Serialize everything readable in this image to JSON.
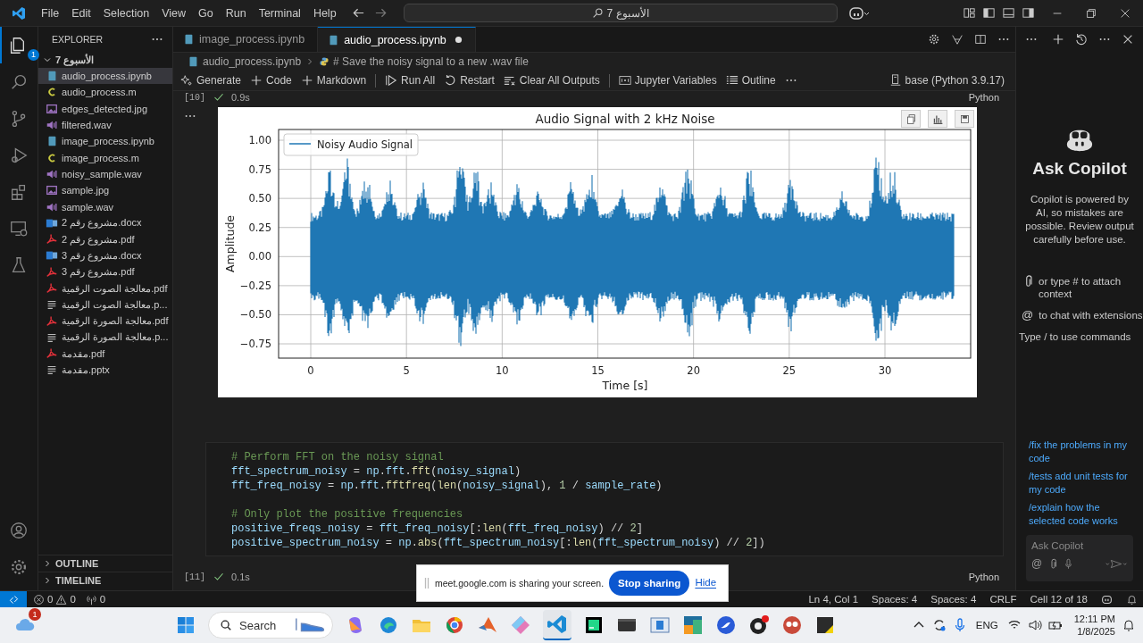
{
  "title_bar": {
    "menu": [
      "File",
      "Edit",
      "Selection",
      "View",
      "Go",
      "Run",
      "Terminal",
      "Help"
    ],
    "search": "الأسبوع 7"
  },
  "activity_bar": {
    "explorer_badge": "1"
  },
  "explorer": {
    "title": "EXPLORER",
    "folder": {
      "name": "الأسبوع 7",
      "expanded": true
    },
    "files": [
      {
        "name": "audio_process.ipynb",
        "kind": "notebook",
        "selected": true
      },
      {
        "name": "audio_process.m",
        "kind": "c",
        "selected": false
      },
      {
        "name": "edges_detected.jpg",
        "kind": "image",
        "selected": false
      },
      {
        "name": "filtered.wav",
        "kind": "audio",
        "selected": false
      },
      {
        "name": "image_process.ipynb",
        "kind": "notebook",
        "selected": false
      },
      {
        "name": "image_process.m",
        "kind": "c",
        "selected": false
      },
      {
        "name": "noisy_sample.wav",
        "kind": "audio",
        "selected": false
      },
      {
        "name": "sample.jpg",
        "kind": "image",
        "selected": false
      },
      {
        "name": "sample.wav",
        "kind": "audio",
        "selected": false
      },
      {
        "name": "مشروع رقم 2.docx",
        "kind": "word",
        "selected": false
      },
      {
        "name": "مشروع رقم 2.pdf",
        "kind": "pdf",
        "selected": false
      },
      {
        "name": "مشروع رقم 3.docx",
        "kind": "word",
        "selected": false
      },
      {
        "name": "مشروع رقم 3.pdf",
        "kind": "pdf",
        "selected": false
      },
      {
        "name": "معالجة الصوت الرقمية.pdf",
        "kind": "pdf",
        "selected": false
      },
      {
        "name": "معالجة الصوت الرقمية.p...",
        "kind": "text",
        "selected": false
      },
      {
        "name": "معالجة الصورة الرقمية.pdf",
        "kind": "pdf",
        "selected": false
      },
      {
        "name": "معالجة الصورة الرقمية.p...",
        "kind": "text",
        "selected": false
      },
      {
        "name": "مقدمة.pdf",
        "kind": "pdf",
        "selected": false
      },
      {
        "name": "مقدمة.pptx",
        "kind": "text",
        "selected": false
      }
    ],
    "sections": [
      {
        "title": "OUTLINE",
        "expanded": false
      },
      {
        "title": "TIMELINE",
        "expanded": false
      }
    ]
  },
  "tabs": [
    {
      "label": "image_process.ipynb",
      "selected": false,
      "modified": false
    },
    {
      "label": "audio_process.ipynb",
      "selected": true,
      "modified": true
    }
  ],
  "breadcrumb": [
    "audio_process.ipynb",
    "# Save the noisy signal to a new .wav file"
  ],
  "toolbar": {
    "actions": [
      {
        "label": "Generate",
        "kind": "sparkle"
      },
      {
        "label": "Code",
        "kind": "plus"
      },
      {
        "label": "Markdown",
        "kind": "plus"
      },
      {
        "label": "Run All",
        "kind": "run"
      },
      {
        "label": "Restart",
        "kind": "restart"
      },
      {
        "label": "Clear All Outputs",
        "kind": "clear"
      },
      {
        "label": "Jupyter Variables",
        "kind": "variables"
      },
      {
        "label": "Outline",
        "kind": "list"
      }
    ],
    "kernel": "base (Python 3.9.17)"
  },
  "output_cell": {
    "exec": "[10]",
    "duration": "0.9s",
    "language": "Python",
    "plot": {
      "title": "Audio Signal with 2 kHz Noise",
      "legend": "Noisy Audio Signal",
      "xlabel": "Time [s]",
      "ylabel": "Amplitude",
      "xticks": [
        "0",
        "5",
        "10",
        "15",
        "20",
        "25",
        "30"
      ],
      "yticks": [
        "1.00",
        "0.75",
        "0.50",
        "0.25",
        "0.00",
        "−0.25",
        "−0.50",
        "−0.75"
      ]
    }
  },
  "code_cell": {
    "exec": "[11]",
    "duration": "0.1s",
    "language": "Python",
    "blocks": [
      [
        [
          {
            "text": "# Perform FFT on the noisy signal",
            "kind": "comment"
          }
        ],
        [
          {
            "text": "fft_spectrum_noisy",
            "kind": "var"
          },
          {
            "text": " = ",
            "kind": "op"
          },
          {
            "text": "np",
            "kind": "var"
          },
          {
            "text": ".",
            "kind": "op"
          },
          {
            "text": "fft",
            "kind": "var"
          },
          {
            "text": ".",
            "kind": "op"
          },
          {
            "text": "fft",
            "kind": "fn"
          },
          {
            "text": "(",
            "kind": "op"
          },
          {
            "text": "noisy_signal",
            "kind": "var"
          },
          {
            "text": ")",
            "kind": "op"
          }
        ],
        [
          {
            "text": "fft_freq_noisy",
            "kind": "var"
          },
          {
            "text": " = ",
            "kind": "op"
          },
          {
            "text": "np",
            "kind": "var"
          },
          {
            "text": ".",
            "kind": "op"
          },
          {
            "text": "fft",
            "kind": "var"
          },
          {
            "text": ".",
            "kind": "op"
          },
          {
            "text": "fftfreq",
            "kind": "fn"
          },
          {
            "text": "(",
            "kind": "op"
          },
          {
            "text": "len",
            "kind": "fn"
          },
          {
            "text": "(",
            "kind": "op"
          },
          {
            "text": "noisy_signal",
            "kind": "var"
          },
          {
            "text": "), ",
            "kind": "op"
          },
          {
            "text": "1",
            "kind": "num"
          },
          {
            "text": " / ",
            "kind": "op"
          },
          {
            "text": "sample_rate",
            "kind": "var"
          },
          {
            "text": ")",
            "kind": "op"
          }
        ]
      ],
      [
        [
          {
            "text": "# Only plot the positive frequencies",
            "kind": "comment"
          }
        ],
        [
          {
            "text": "positive_freqs_noisy",
            "kind": "var"
          },
          {
            "text": " = ",
            "kind": "op"
          },
          {
            "text": "fft_freq_noisy",
            "kind": "var"
          },
          {
            "text": "[:",
            "kind": "op"
          },
          {
            "text": "len",
            "kind": "fn"
          },
          {
            "text": "(",
            "kind": "op"
          },
          {
            "text": "fft_freq_noisy",
            "kind": "var"
          },
          {
            "text": ") // ",
            "kind": "op"
          },
          {
            "text": "2",
            "kind": "num"
          },
          {
            "text": "]",
            "kind": "op"
          }
        ],
        [
          {
            "text": "positive_spectrum_noisy",
            "kind": "var"
          },
          {
            "text": " = ",
            "kind": "op"
          },
          {
            "text": "np",
            "kind": "var"
          },
          {
            "text": ".",
            "kind": "op"
          },
          {
            "text": "abs",
            "kind": "fn"
          },
          {
            "text": "(",
            "kind": "op"
          },
          {
            "text": "fft_spectrum_noisy",
            "kind": "var"
          },
          {
            "text": "[:",
            "kind": "op"
          },
          {
            "text": "len",
            "kind": "fn"
          },
          {
            "text": "(",
            "kind": "op"
          },
          {
            "text": "fft_spectrum_noisy",
            "kind": "var"
          },
          {
            "text": ") // ",
            "kind": "op"
          },
          {
            "text": "2",
            "kind": "num"
          },
          {
            "text": "])",
            "kind": "op"
          }
        ]
      ]
    ]
  },
  "sharing_bar": {
    "message": "meet.google.com is sharing your screen.",
    "stop": "Stop sharing",
    "hide": "Hide"
  },
  "copilot": {
    "title": "Ask Copilot",
    "description": "Copilot is powered by AI, so mistakes are possible. Review output carefully before use.",
    "hints": [
      {
        "kind": "attach",
        "text": "or type # to attach context"
      },
      {
        "kind": "mention",
        "symbol": "@",
        "text": "to chat with extensions"
      },
      {
        "kind": "plain",
        "text": "Type / to use commands"
      }
    ],
    "suggestions": [
      "/fix the problems in my code",
      "/tests add unit tests for my code",
      "/explain how the selected code works"
    ],
    "input": {
      "placeholder": "Ask Copilot",
      "symbol": "@"
    }
  },
  "status_bar": {
    "errors": "0",
    "warnings": "0",
    "ports": "0",
    "items": [
      "Ln 4, Col 1",
      "Spaces: 4",
      "Spaces: 4",
      "CRLF",
      "Cell 12 of 18"
    ]
  },
  "taskbar": {
    "weather_badge": "1",
    "search": "Search",
    "language": "ENG",
    "time": "12:11 PM",
    "date": "1/8/2025"
  }
}
